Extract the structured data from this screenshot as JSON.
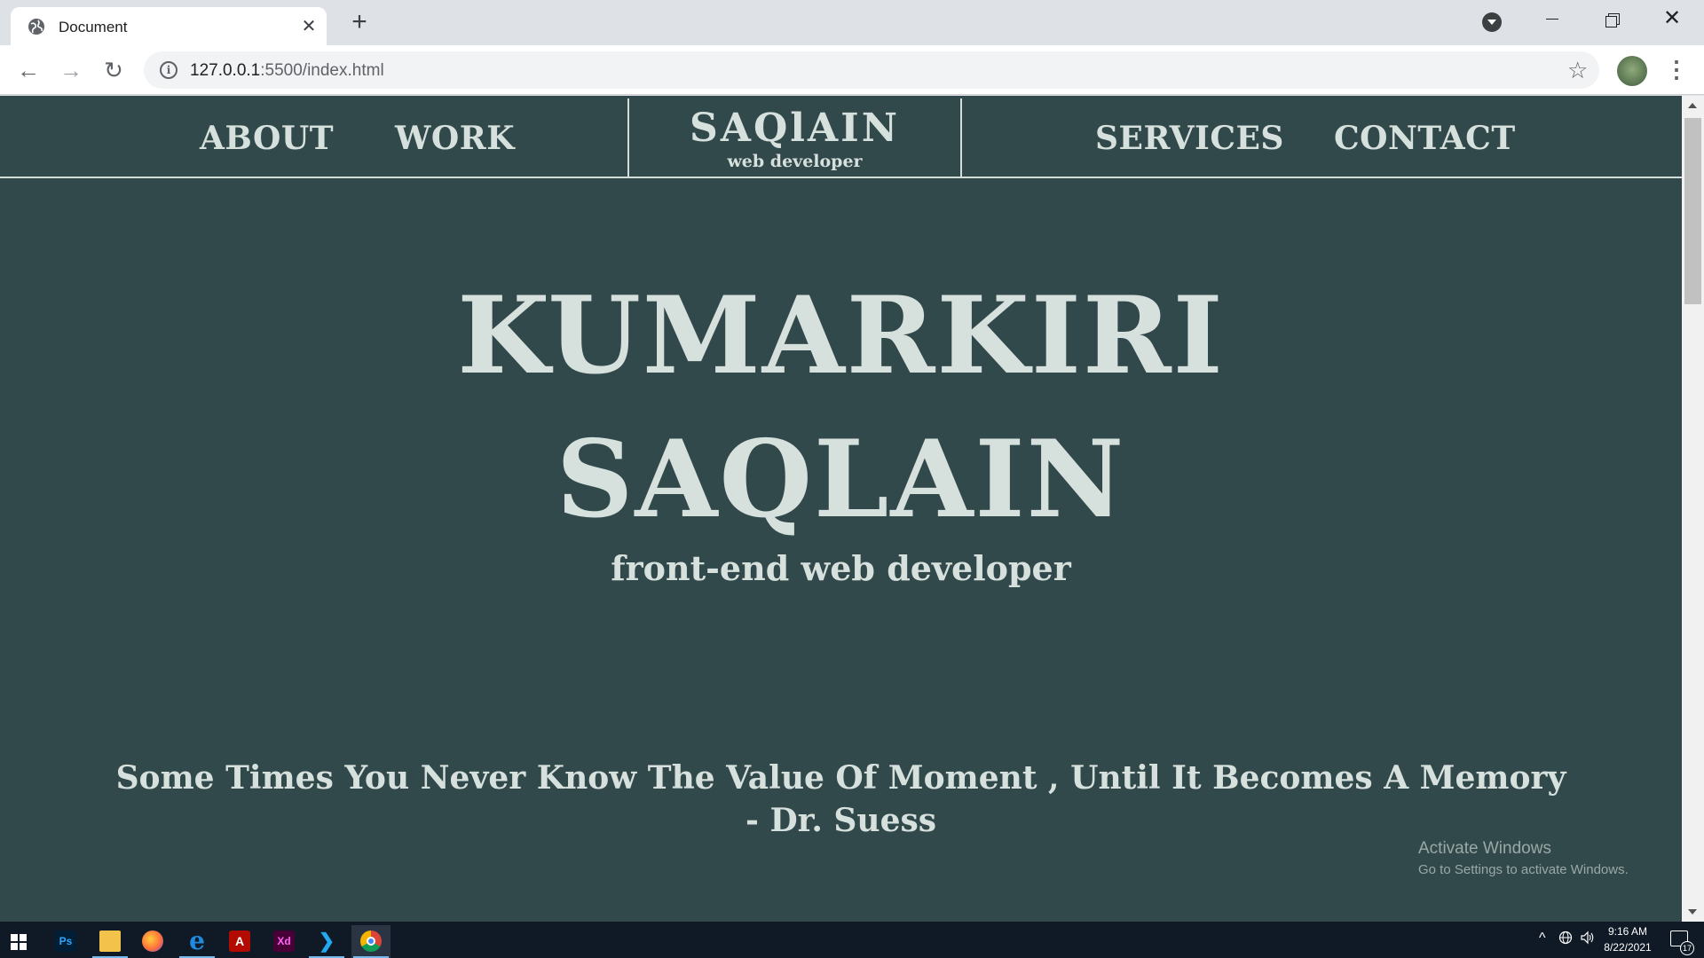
{
  "browser": {
    "tab_title": "Document",
    "tab_close": "✕",
    "new_tab": "+",
    "url_host": "127.0.0.1",
    "url_path": ":5500/index.html",
    "back": "←",
    "forward": "→",
    "reload": "↻",
    "bookmark": "☆",
    "menu": "⋮",
    "info": "i",
    "window_close": "✕"
  },
  "site": {
    "nav": {
      "about": "ABOUT",
      "work": "WORK",
      "services": "SERVICES",
      "contact": "CONTACT"
    },
    "brand": {
      "name": "SAQlAIN",
      "sub": "web developer"
    },
    "hero": {
      "line1": "KUMARKIRI",
      "line2": "SAQLAIN",
      "sub": "front-end web developer"
    },
    "quote": {
      "text": "Some Times You Never Know The Value Of Moment , Until It Becomes A Memory",
      "author": "- Dr. Suess"
    }
  },
  "watermark": {
    "title": "Activate Windows",
    "subtitle": "Go to Settings to activate Windows."
  },
  "taskbar": {
    "apps": [
      {
        "name": "photoshop-icon",
        "glyph": "Ps"
      },
      {
        "name": "file-explorer-icon",
        "glyph": ""
      },
      {
        "name": "firefox-icon",
        "glyph": ""
      },
      {
        "name": "edge-icon",
        "glyph": "e"
      },
      {
        "name": "acrobat-icon",
        "glyph": "A"
      },
      {
        "name": "xd-icon",
        "glyph": "Xd"
      },
      {
        "name": "vscode-icon",
        "glyph": "❯"
      },
      {
        "name": "chrome-icon",
        "glyph": ""
      }
    ],
    "time": "9:16 AM",
    "date": "8/22/2021",
    "tray_chevron": "^",
    "notification_count": "17"
  },
  "colors": {
    "page_background": "#32494b",
    "page_text": "#d6e0dc"
  }
}
